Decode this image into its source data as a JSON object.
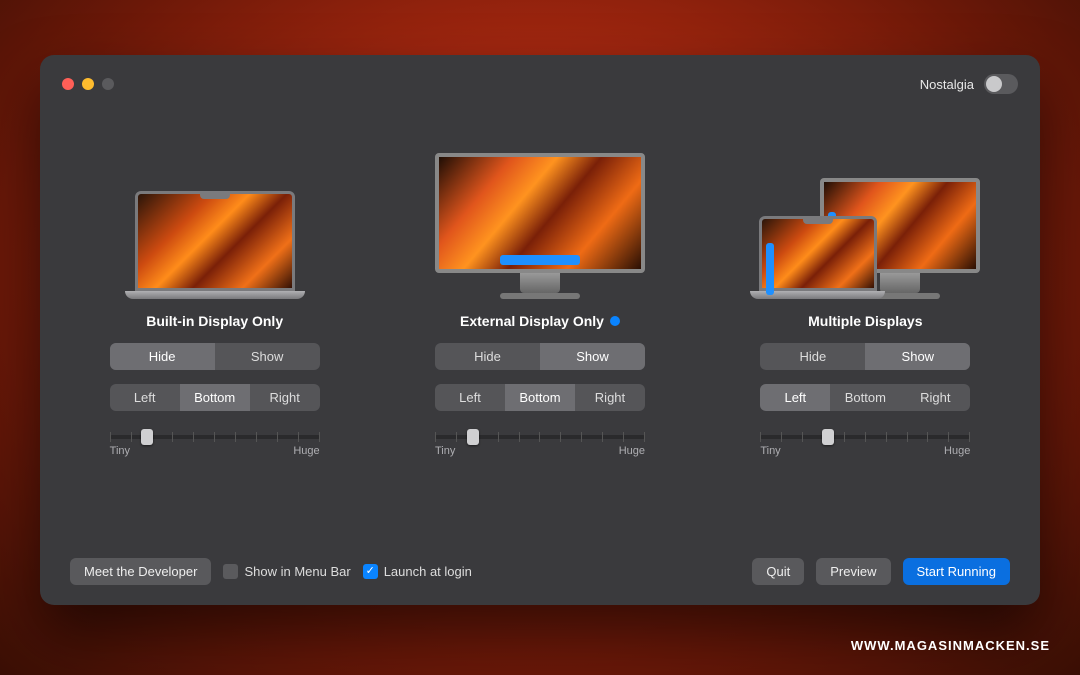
{
  "header": {
    "nostalgia_label": "Nostalgia",
    "nostalgia_on": false
  },
  "columns": [
    {
      "id": "builtin",
      "title": "Built-in Display Only",
      "active": false,
      "device": "laptop",
      "visibility": {
        "options": [
          "Hide",
          "Show"
        ],
        "selected": "Hide"
      },
      "position": {
        "options": [
          "Left",
          "Bottom",
          "Right"
        ],
        "selected": "Bottom"
      },
      "slider": {
        "min_label": "Tiny",
        "max_label": "Huge",
        "value_pct": 18
      }
    },
    {
      "id": "external",
      "title": "External Display Only",
      "active": true,
      "device": "monitor",
      "dock": "bottom",
      "visibility": {
        "options": [
          "Hide",
          "Show"
        ],
        "selected": "Show"
      },
      "position": {
        "options": [
          "Left",
          "Bottom",
          "Right"
        ],
        "selected": "Bottom"
      },
      "slider": {
        "min_label": "Tiny",
        "max_label": "Huge",
        "value_pct": 18
      }
    },
    {
      "id": "multiple",
      "title": "Multiple Displays",
      "active": false,
      "device": "multi",
      "dock": "left",
      "visibility": {
        "options": [
          "Hide",
          "Show"
        ],
        "selected": "Show"
      },
      "position": {
        "options": [
          "Left",
          "Bottom",
          "Right"
        ],
        "selected": "Left"
      },
      "slider": {
        "min_label": "Tiny",
        "max_label": "Huge",
        "value_pct": 32
      }
    }
  ],
  "footer": {
    "meet_dev": "Meet the Developer",
    "show_menubar": {
      "label": "Show in Menu Bar",
      "checked": false
    },
    "launch_login": {
      "label": "Launch at login",
      "checked": true
    },
    "quit": "Quit",
    "preview": "Preview",
    "start": "Start Running"
  },
  "watermark": "WWW.MAGASINMACKEN.SE"
}
